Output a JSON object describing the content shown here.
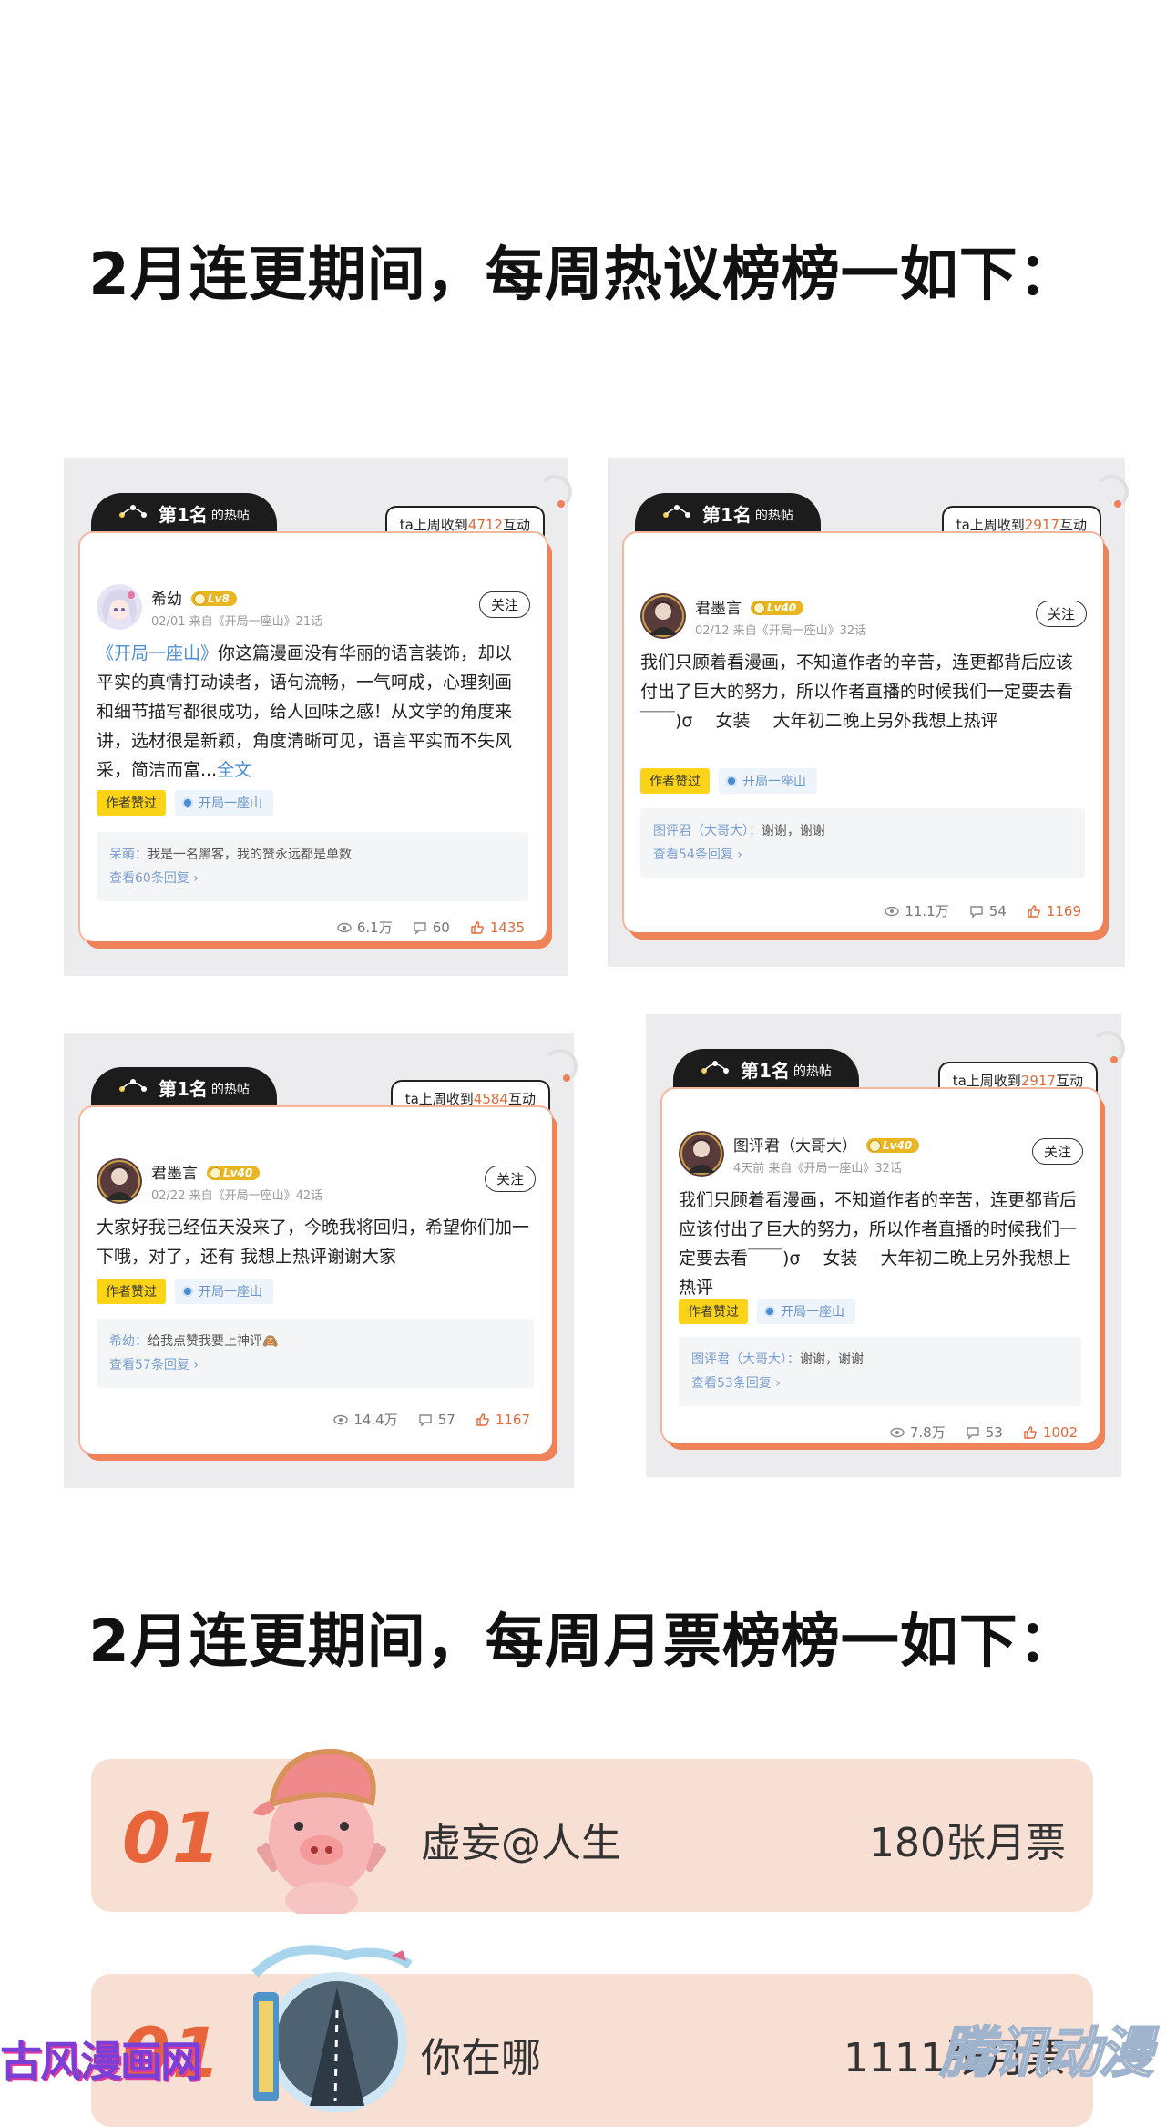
{
  "headings": {
    "hot_posts": "2月连更期间，每周热议榜榜一如下：",
    "monthly_tickets": "2月连更期间，每周月票榜榜一如下："
  },
  "colors": {
    "accent": "#e8643a",
    "tag_yellow": "#fbd419",
    "link_blue": "#4a8dd6"
  },
  "posts": [
    {
      "rank_label": "第1名",
      "rank_suffix": "的热帖",
      "interactions_prefix": "ta上周收到",
      "interactions_value": "4712",
      "interactions_suffix": "互动",
      "username": "希幼",
      "level": "Lv8",
      "meta": "02/01 来自《开局一座山》21话",
      "follow_label": "关注",
      "content_link": "《开局一座山》",
      "content": "你这篇漫画没有华丽的语言装饰，却以平实的真情打动读者，语句流畅，一气呵成，心理刻画和细节描写都很成功，给人回味之感！从文学的角度来讲，选材很是新颖，角度清晰可见，语言平实而不失风采，简洁而富...",
      "more_label": "全文",
      "tag_author": "作者赞过",
      "tag_comic": "开局一座山",
      "reply_user": "呆萌：",
      "reply_text": "我是一名黑客，我的赞永远都是单数",
      "view_replies": "查看60条回复 ›",
      "views": "6.1万",
      "comments": "60",
      "likes": "1435",
      "avatar_icon": "anime-girl-avatar"
    },
    {
      "rank_label": "第1名",
      "rank_suffix": "的热帖",
      "interactions_prefix": "ta上周收到",
      "interactions_value": "2917",
      "interactions_suffix": "互动",
      "username": "君墨言",
      "level": "Lv40",
      "meta": "02/12 来自《开局一座山》32话",
      "follow_label": "关注",
      "content_link": "",
      "content": "我们只顾着看漫画，不知道作者的辛苦，连更都背后应该付出了巨大的努力，所以作者直播的时候我们一定要去看￣￣)σ　 女装　 大年初二晚上另外我想上热评",
      "more_label": "",
      "tag_author": "作者赞过",
      "tag_comic": "开局一座山",
      "reply_user": "图评君（大哥大）：",
      "reply_text": "谢谢，谢谢",
      "view_replies": "查看54条回复 ›",
      "views": "11.1万",
      "comments": "54",
      "likes": "1169",
      "avatar_icon": "dark-character-avatar"
    },
    {
      "rank_label": "第1名",
      "rank_suffix": "的热帖",
      "interactions_prefix": "ta上周收到",
      "interactions_value": "4584",
      "interactions_suffix": "互动",
      "username": "君墨言",
      "level": "Lv40",
      "meta": "02/22 来自《开局一座山》42话",
      "follow_label": "关注",
      "content_link": "",
      "content": "大家好我已经伍天没来了，今晚我将回归，希望你们加一下哦，对了，还有 我想上热评谢谢大家",
      "more_label": "",
      "tag_author": "作者赞过",
      "tag_comic": "开局一座山",
      "reply_user": "希幼：",
      "reply_text": "给我点赞我要上神评🙈",
      "view_replies": "查看57条回复 ›",
      "views": "14.4万",
      "comments": "57",
      "likes": "1167",
      "avatar_icon": "dark-character-avatar"
    },
    {
      "rank_label": "第1名",
      "rank_suffix": "的热帖",
      "interactions_prefix": "ta上周收到",
      "interactions_value": "2917",
      "interactions_suffix": "互动",
      "username": "图评君（大哥大）",
      "level": "Lv40",
      "meta": "4天前 来自《开局一座山》32话",
      "follow_label": "关注",
      "content_link": "",
      "content": "我们只顾着看漫画，不知道作者的辛苦，连更都背后应该付出了巨大的努力，所以作者直播的时候我们一定要去看￣￣)σ　 女装　 大年初二晚上另外我想上热评",
      "more_label": "",
      "tag_author": "作者赞过",
      "tag_comic": "开局一座山",
      "reply_user": "图评君（大哥大）：",
      "reply_text": "谢谢，谢谢",
      "view_replies": "查看53条回复 ›",
      "views": "7.8万",
      "comments": "53",
      "likes": "1002",
      "avatar_icon": "dark-character-avatar"
    }
  ],
  "ranking": [
    {
      "rank": "01",
      "name": "虚妄@人生",
      "votes": "180张月票",
      "avatar_icon": "cartoon-pig-avatar"
    },
    {
      "rank": "01",
      "name": "你在哪",
      "votes": "1111张月票",
      "avatar_icon": "road-winged-frame-avatar"
    }
  ],
  "watermarks": {
    "left": "古风漫画网",
    "right": "腾讯动漫"
  }
}
